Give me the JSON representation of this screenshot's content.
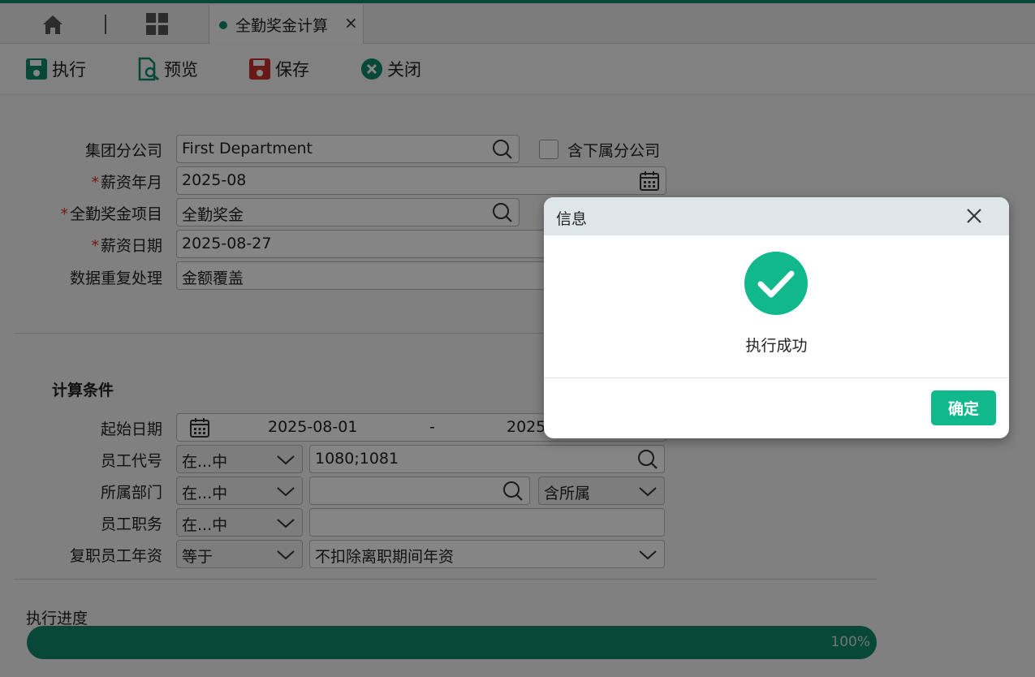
{
  "tabs": {
    "active_label": "全勤奖金计算",
    "close_glyph": "×"
  },
  "toolbar": {
    "execute": "执行",
    "preview": "预览",
    "save": "保存",
    "close": "关闭"
  },
  "form": {
    "company_label": "集团分公司",
    "company_value": "First Department",
    "include_sub_label": "含下属分公司",
    "month_label": "薪资年月",
    "month_value": "2025-08",
    "bonus_label": "全勤奖金项目",
    "bonus_value": "全勤奖金",
    "paydate_label": "薪资日期",
    "paydate_value": "2025-08-27",
    "dup_label": "数据重复处理",
    "dup_value": "金额覆盖",
    "required_mark": "*"
  },
  "conditions": {
    "title": "计算条件",
    "start_label": "起始日期",
    "start_from": "2025-08-01",
    "range_sep": "-",
    "start_to": "2025",
    "emp_code_label": "员工代号",
    "emp_code_op": "在...中",
    "emp_code_value": "1080;1081",
    "dept_label": "所属部门",
    "dept_op": "在...中",
    "dept_value": "",
    "dept_scope": "含所属",
    "duty_label": "员工职务",
    "duty_op": "在...中",
    "duty_value": "",
    "seniority_label": "复职员工年资",
    "seniority_op": "等于",
    "seniority_value": "不扣除离职期间年资"
  },
  "progress": {
    "label": "执行进度",
    "percent_text": "100%",
    "value": 100
  },
  "dialog": {
    "title": "信息",
    "message": "执行成功",
    "ok": "确定"
  },
  "colors": {
    "accent": "#0f8a6b",
    "success": "#10b88c",
    "required": "#d9322a"
  }
}
